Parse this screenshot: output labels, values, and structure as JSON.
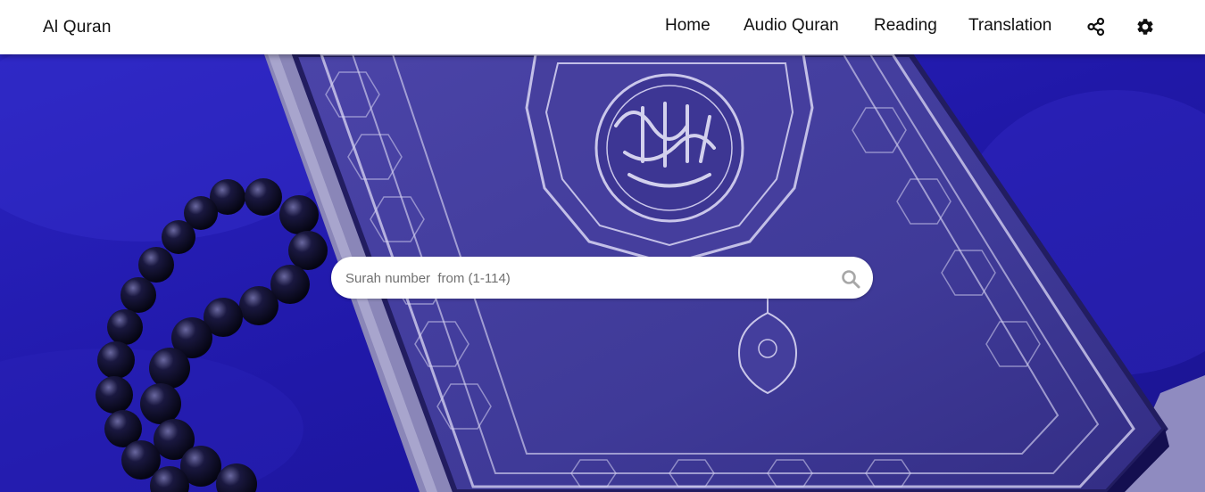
{
  "brand": {
    "title": "Al Quran"
  },
  "nav": {
    "items": [
      {
        "label": "Home"
      },
      {
        "label": "Audio Quran"
      },
      {
        "label": "Reading"
      },
      {
        "label": "Translation"
      }
    ],
    "icons": [
      "share-icon",
      "gear-icon"
    ]
  },
  "search": {
    "placeholder": "Surah number  from (1-114)",
    "icon": "search-icon"
  },
  "colors": {
    "navbar": "#ffffff",
    "hero_tint": "#2a22b8",
    "search_bg": "#ffffff",
    "icon_grey": "#a7a7a7"
  }
}
